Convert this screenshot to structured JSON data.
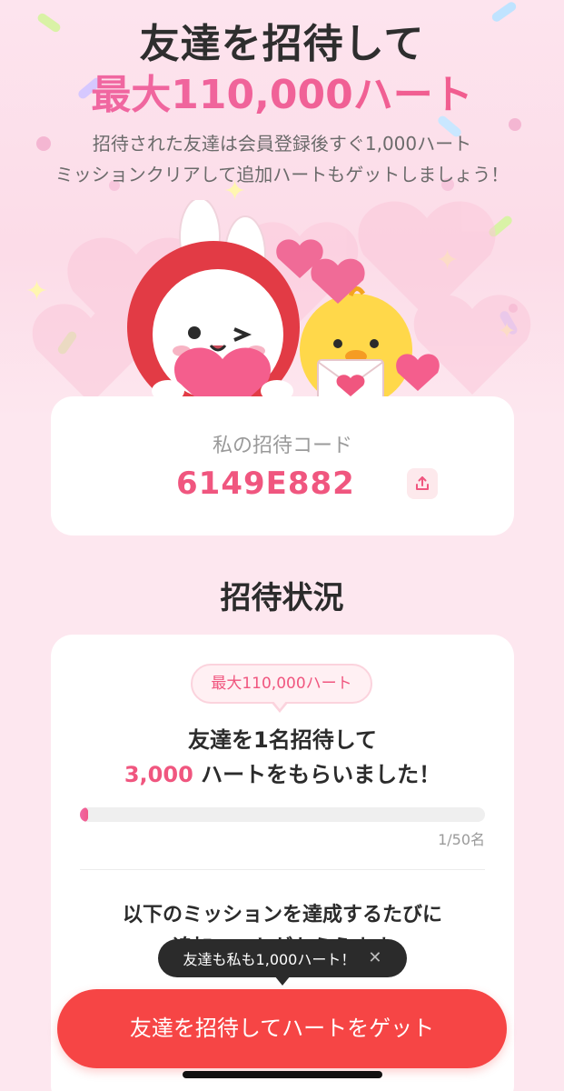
{
  "hero": {
    "title_line1": "友達を招待して",
    "title_line2": "最大110,000ハート",
    "subtitle_line1": "招待された友達は会員登録後すぐ1,000ハート",
    "subtitle_line2": "ミッションクリアして追加ハートもゲットしましょう！"
  },
  "invite_code": {
    "label": "私の招待コード",
    "code": "6149E882"
  },
  "status": {
    "section_title": "招待状況",
    "badge": "最大110,000ハート",
    "line1": "友達を1名招待して",
    "hearts_amount": "3,000",
    "line2_suffix": " ハートをもらいました！",
    "progress_fraction": 0.02,
    "progress_label": "1/50名",
    "mission_line1": "以下のミッションを達成するたびに",
    "mission_line2": "追加ハートがもらえます"
  },
  "tooltip": {
    "text": "友達も私も1,000ハート！",
    "close_glyph": "✕"
  },
  "cta": {
    "label": "友達を招待してハートをゲット"
  },
  "colors": {
    "accent_pink": "#f0567f",
    "cta_red": "#f64545",
    "background": "#fde7ef"
  }
}
